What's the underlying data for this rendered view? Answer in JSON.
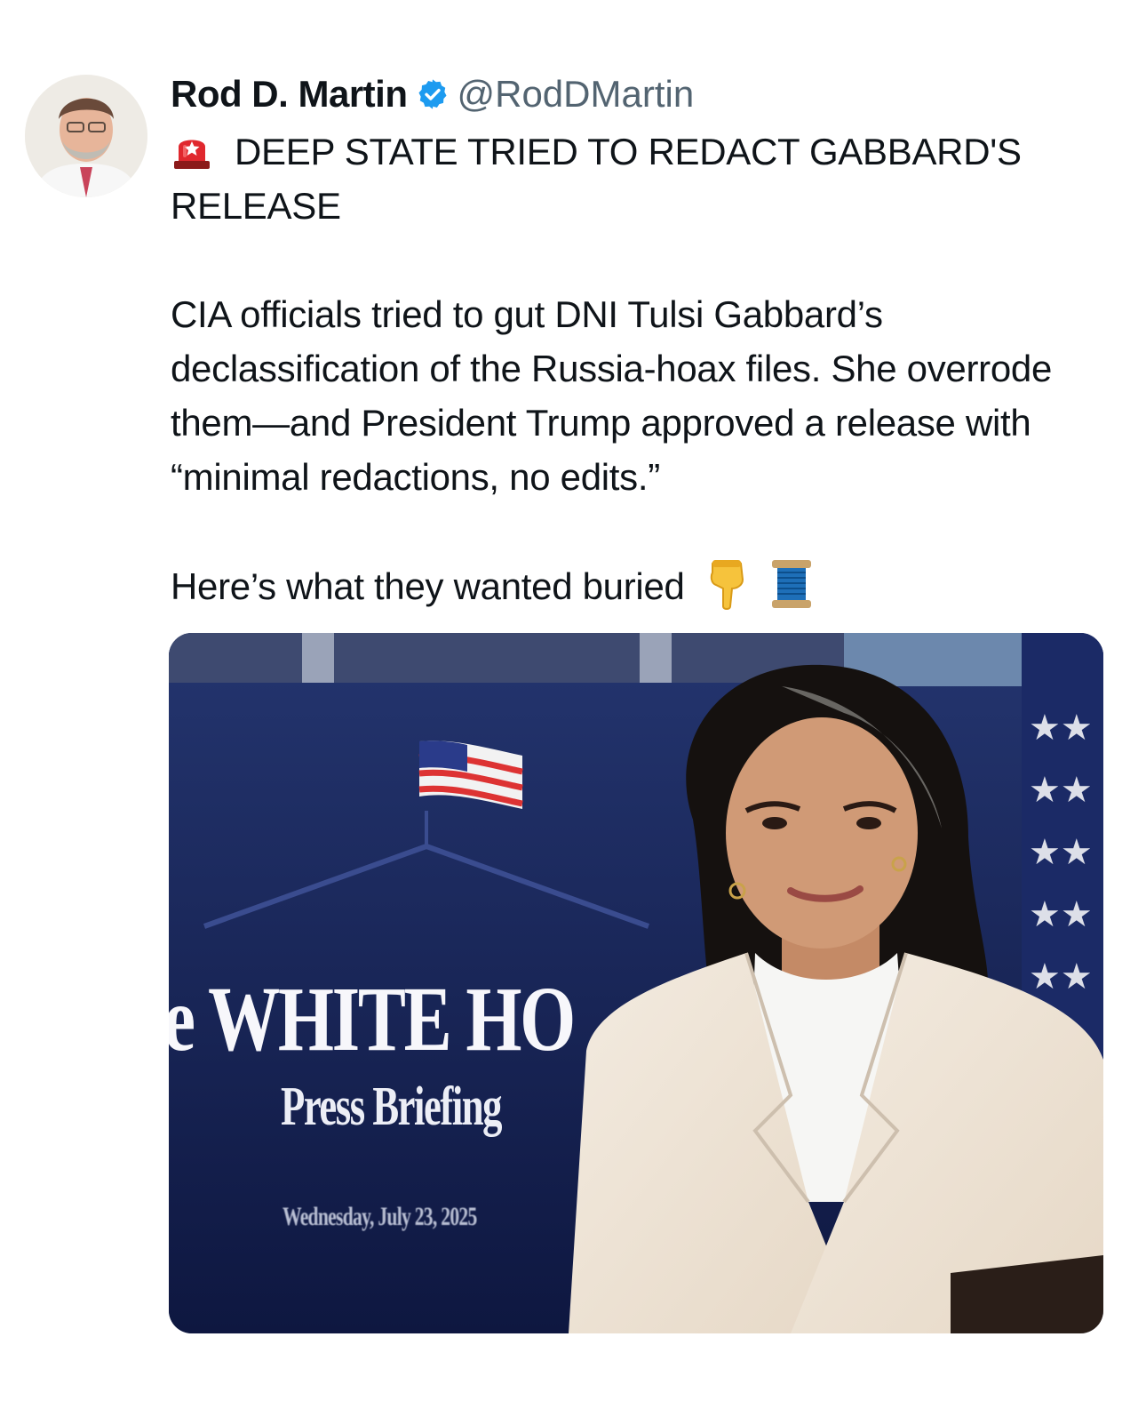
{
  "tweet": {
    "author": {
      "display_name": "Rod D. Martin",
      "handle": "@RodDMartin",
      "verified": true
    },
    "headline": "DEEP STATE TRIED TO REDACT GABBARD'S RELEASE",
    "headline_icon": "police-light-emoji",
    "paragraph": "CIA officials tried to gut DNI Tulsi Gabbard’s declassification of the Russia-hoax files. She overrode them—and President Trump approved a release with “minimal redactions, no edits.”",
    "closing": "Here’s what they wanted buried",
    "closing_icons": [
      "pointing-down-emoji",
      "thread-spool-emoji"
    ],
    "media": {
      "backdrop_title": "e WHITE HO",
      "backdrop_subtitle": "Press Briefing",
      "backdrop_date": "Wednesday, July 23, 2025"
    }
  },
  "colors": {
    "text": "#0f1419",
    "handle": "#536471",
    "verified": "#1d9bf0",
    "backdrop_blue": "#1b2b66"
  }
}
